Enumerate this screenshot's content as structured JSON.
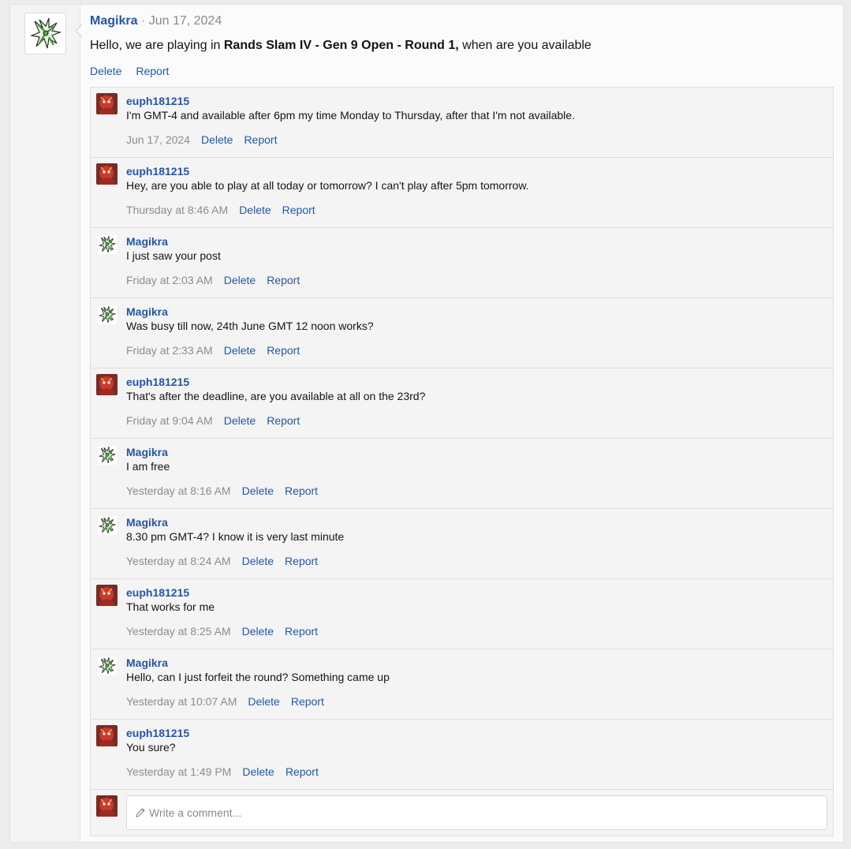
{
  "post": {
    "author": "Magikra",
    "separator": "·",
    "date": "Jun 17, 2024",
    "body_prefix": "Hello, we are playing in ",
    "body_bold": "Rands Slam IV - Gen 9 Open - Round 1,",
    "body_suffix": " when are you available",
    "delete_label": "Delete",
    "report_label": "Report"
  },
  "comments": [
    {
      "user": "euph181215",
      "avatar": "red",
      "text": "I'm GMT-4 and available after 6pm my time Monday to Thursday, after that I'm not available.",
      "time": "Jun 17, 2024",
      "delete": "Delete",
      "report": "Report"
    },
    {
      "user": "euph181215",
      "avatar": "red",
      "text": "Hey, are you able to play at all today or tomorrow? I can't play after 5pm tomorrow.",
      "time": "Thursday at 8:46 AM",
      "delete": "Delete",
      "report": "Report"
    },
    {
      "user": "Magikra",
      "avatar": "green",
      "text": "I just saw your post",
      "time": "Friday at 2:03 AM",
      "delete": "Delete",
      "report": "Report"
    },
    {
      "user": "Magikra",
      "avatar": "green",
      "text": "Was busy till now, 24th June GMT 12 noon works?",
      "time": "Friday at 2:33 AM",
      "delete": "Delete",
      "report": "Report"
    },
    {
      "user": "euph181215",
      "avatar": "red",
      "text": "That's after the deadline, are you available at all on the 23rd?",
      "time": "Friday at 9:04 AM",
      "delete": "Delete",
      "report": "Report"
    },
    {
      "user": "Magikra",
      "avatar": "green",
      "text": "I am free",
      "time": "Yesterday at 8:16 AM",
      "delete": "Delete",
      "report": "Report"
    },
    {
      "user": "Magikra",
      "avatar": "green",
      "text": "8.30 pm GMT-4? I know it is very last minute",
      "time": "Yesterday at 8:24 AM",
      "delete": "Delete",
      "report": "Report"
    },
    {
      "user": "euph181215",
      "avatar": "red",
      "text": "That works for me",
      "time": "Yesterday at 8:25 AM",
      "delete": "Delete",
      "report": "Report"
    },
    {
      "user": "Magikra",
      "avatar": "green",
      "text": "Hello, can I just forfeit the round? Something came up",
      "time": "Yesterday at 10:07 AM",
      "delete": "Delete",
      "report": "Report"
    },
    {
      "user": "euph181215",
      "avatar": "red",
      "text": "You sure?",
      "time": "Yesterday at 1:49 PM",
      "delete": "Delete",
      "report": "Report"
    }
  ],
  "composer": {
    "placeholder": "Write a comment...",
    "icon": "pencil-icon"
  },
  "colors": {
    "link": "#2456a6",
    "meta": "#8c8c8c"
  }
}
